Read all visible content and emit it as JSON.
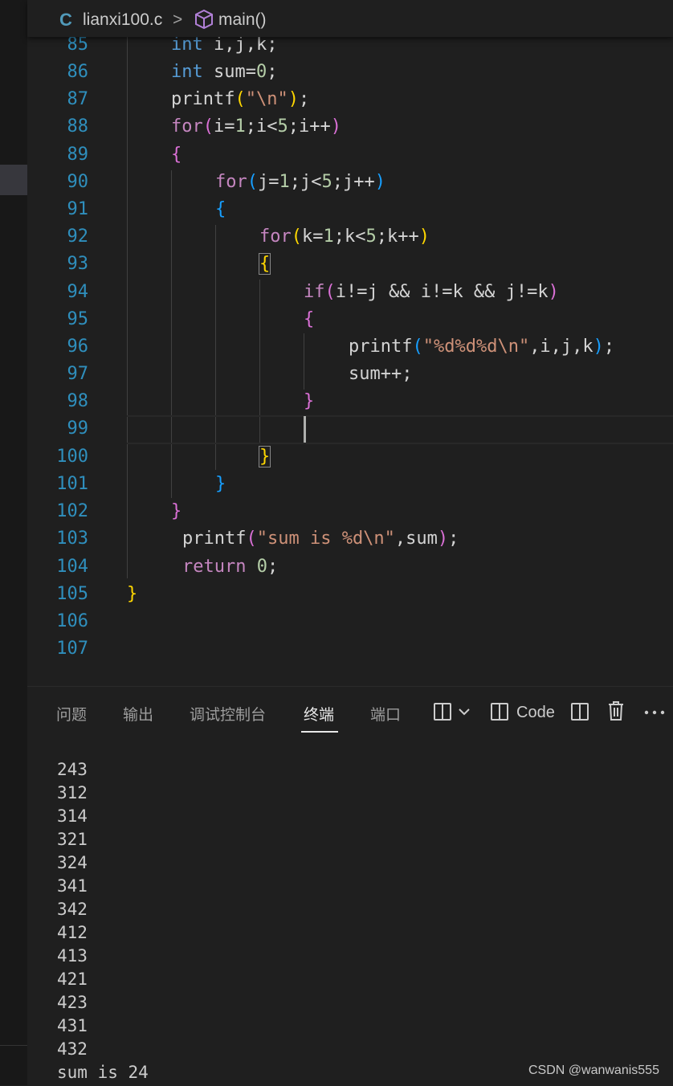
{
  "breadcrumb": {
    "lang_icon": "C",
    "file": "lianxi100.c",
    "separator": ">",
    "symbol_icon": "cube-icon",
    "function": "main()"
  },
  "editor": {
    "line_numbers": [
      "85",
      "86",
      "87",
      "88",
      "89",
      "90",
      "91",
      "92",
      "93",
      "94",
      "95",
      "96",
      "97",
      "98",
      "99",
      "100",
      "101",
      "102",
      "103",
      "104",
      "105",
      "106",
      "107"
    ]
  },
  "panel": {
    "tabs": [
      "问题",
      "输出",
      "调试控制台",
      "终端",
      "端口"
    ],
    "active_tab": "终端",
    "code_label": "Code",
    "icons": [
      "split-layout-icon",
      "chevron-down-icon",
      "split-code-icon",
      "split-terminal-icon",
      "trash-icon",
      "more-icon"
    ]
  },
  "terminal": {
    "lines": [
      "243",
      "312",
      "314",
      "321",
      "324",
      "341",
      "342",
      "412",
      "413",
      "421",
      "423",
      "431",
      "432",
      "sum is 24"
    ]
  },
  "watermark": "CSDN @wanwanis555",
  "colors": {
    "background": "#1f1f1f",
    "line_number": "#2f8fbd",
    "keyword": "#569cd6",
    "string": "#ce9178",
    "number": "#b5cea8"
  }
}
